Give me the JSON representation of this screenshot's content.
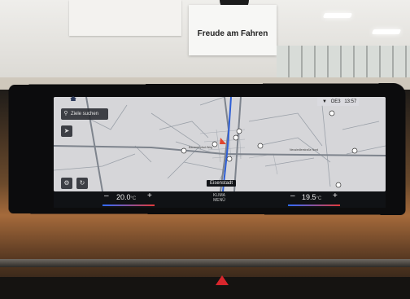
{
  "signage": {
    "brand_slogan": "Freude am Fahren"
  },
  "navigation": {
    "search_placeholder": "Ziele suchen",
    "current_place": "Eisenstadt",
    "map_place_labels": [
      "Bananenpfad-Weg",
      "Neusiedlerstraße Nord"
    ]
  },
  "status_bar": {
    "network": "OE3",
    "time": "13:57"
  },
  "climate": {
    "left_temp": "20.0",
    "right_temp": "19.5",
    "unit": "°C",
    "minus": "–",
    "plus": "+",
    "center_line1": "KLIMA",
    "center_line2": "MENÜ"
  },
  "icons": [
    "search-icon",
    "home-icon",
    "compass-icon",
    "settings-icon",
    "route-icon",
    "location-arrow-icon",
    "poi-icon",
    "hazard-icon"
  ],
  "colors": {
    "map_bg": "#d6d6d9",
    "road": "#8a8f98",
    "route": "#2f5fd6",
    "hazard": "#d8262c"
  }
}
